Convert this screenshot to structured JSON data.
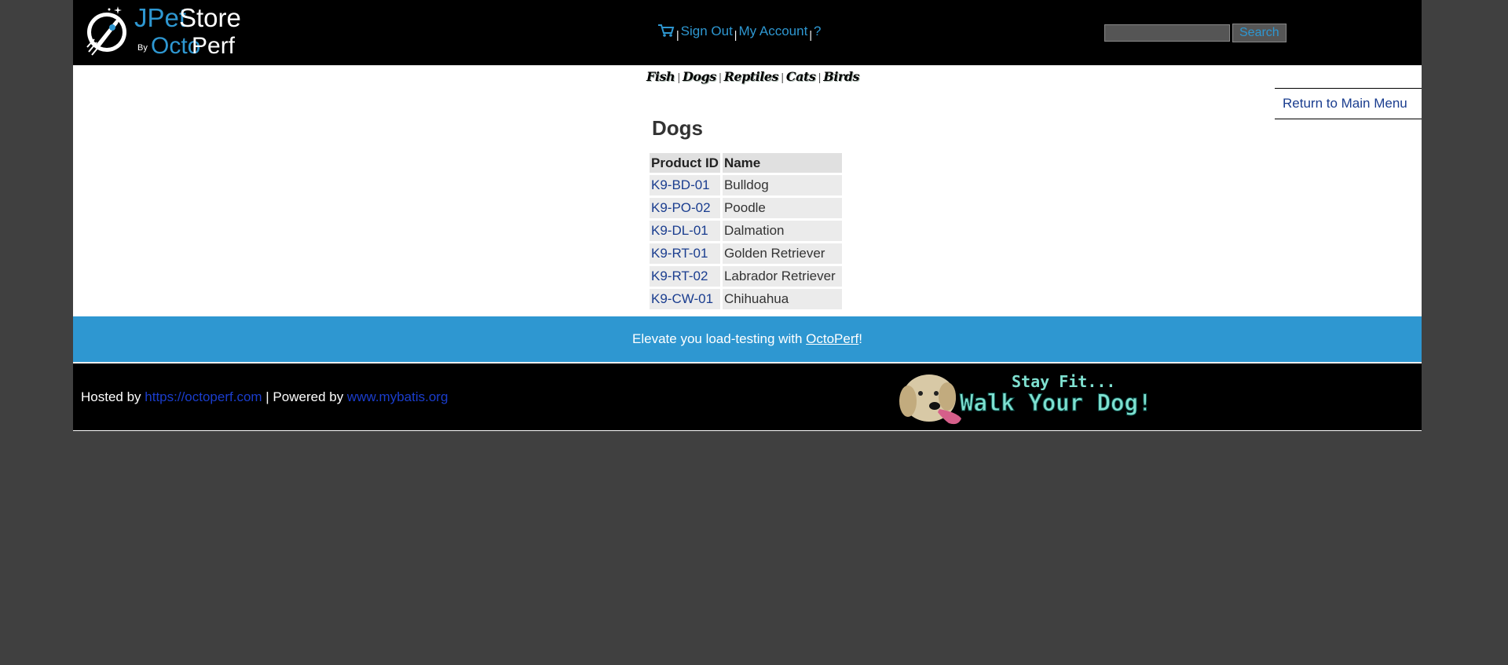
{
  "header": {
    "logo": {
      "brand_first": "JPet",
      "brand_second": "Store",
      "by": "By",
      "sub_first": "Octo",
      "sub_second": "Perf"
    },
    "menu": {
      "cart_icon": "shopping-cart-icon",
      "sign_out": "Sign Out",
      "my_account": "My Account",
      "help": "?",
      "separator": "|"
    },
    "search": {
      "value": "",
      "button_label": "Search"
    }
  },
  "quicklinks": [
    "Fish",
    "Dogs",
    "Reptiles",
    "Cats",
    "Birds"
  ],
  "return_link": "Return to Main Menu",
  "category": {
    "title": "Dogs",
    "columns": [
      "Product ID",
      "Name"
    ],
    "products": [
      {
        "id": "K9-BD-01",
        "name": "Bulldog"
      },
      {
        "id": "K9-PO-02",
        "name": "Poodle"
      },
      {
        "id": "K9-DL-01",
        "name": "Dalmation"
      },
      {
        "id": "K9-RT-01",
        "name": "Golden Retriever"
      },
      {
        "id": "K9-RT-02",
        "name": "Labrador Retriever"
      },
      {
        "id": "K9-CW-01",
        "name": "Chihuahua"
      }
    ]
  },
  "banner": {
    "text_before": "Elevate you load-testing with ",
    "link": "OctoPerf",
    "text_after": "!"
  },
  "footer": {
    "hosted_by": "Hosted by ",
    "hosted_link": "https://octoperf.com",
    "powered_by": " | Powered by ",
    "powered_link": "www.mybatis.org",
    "ad_line1": "Stay Fit...",
    "ad_line2": "Walk Your Dog!"
  },
  "colors": {
    "page_bg": "#404040",
    "header_bg": "#000000",
    "accent": "#2e97d1",
    "link": "#1a3d8f",
    "ad_text": "#7fe0d0"
  }
}
